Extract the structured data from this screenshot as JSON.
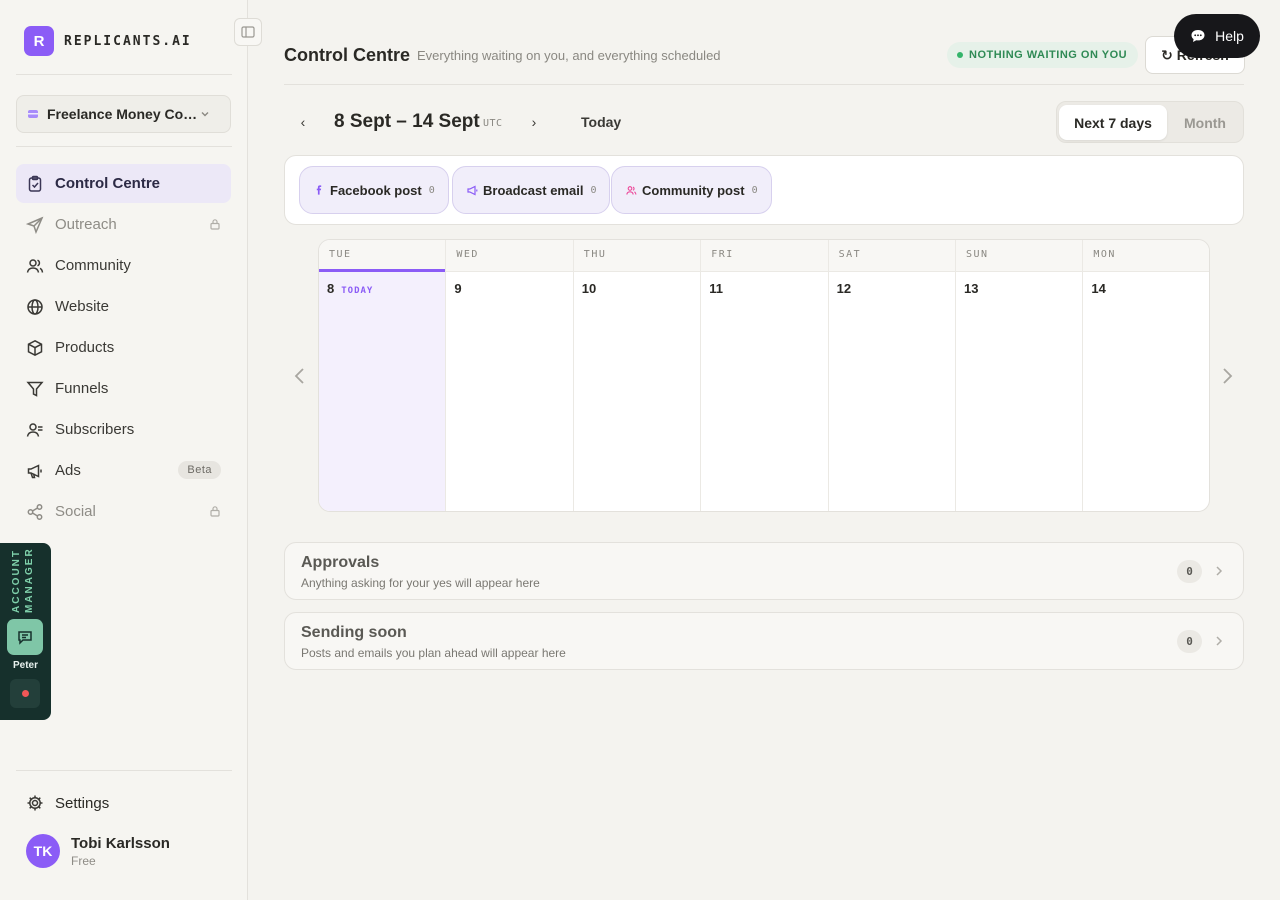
{
  "brand": {
    "logo_letter": "R",
    "name": "REPLICANTS.AI",
    "accent_color": "#8b5cf6"
  },
  "workspace": {
    "label": "Freelance Money Con..."
  },
  "sidebar": {
    "items": [
      {
        "label": "Control Centre",
        "icon": "clipboard-check-icon",
        "active": true
      },
      {
        "label": "Outreach",
        "icon": "send-icon",
        "locked": true
      },
      {
        "label": "Community",
        "icon": "users-icon"
      },
      {
        "label": "Website",
        "icon": "globe-icon"
      },
      {
        "label": "Products",
        "icon": "box-icon"
      },
      {
        "label": "Funnels",
        "icon": "funnel-icon"
      },
      {
        "label": "Subscribers",
        "icon": "subscribers-icon"
      },
      {
        "label": "Ads",
        "icon": "megaphone-icon",
        "badge": "Beta"
      },
      {
        "label": "Social",
        "icon": "share-icon",
        "locked": true
      }
    ],
    "settings_label": "Settings"
  },
  "user": {
    "initials": "TK",
    "name": "Tobi Karlsson",
    "plan": "Free"
  },
  "account_manager": {
    "label": "ACCOUNT MANAGER",
    "name": "Peter",
    "status_color": "#f25757"
  },
  "header": {
    "title": "Control Centre",
    "subtitle": "Everything waiting on you, and everything scheduled",
    "status": "NOTHING WAITING ON YOU",
    "refresh_label": "↻ Refresh",
    "help_label": "Help"
  },
  "week": {
    "prev": "‹",
    "range": "8 Sept – 14 Sept",
    "timezone": "UTC",
    "next": "›",
    "today_label": "Today",
    "views": [
      "Next 7 days",
      "Month"
    ],
    "selected_view": "Next 7 days"
  },
  "filters": [
    {
      "label": "Facebook post",
      "count": "0",
      "icon": "facebook-icon",
      "color": "#8b5cf6"
    },
    {
      "label": "Broadcast email",
      "count": "0",
      "icon": "megaphone-small-icon",
      "color": "#8b5cf6"
    },
    {
      "label": "Community post",
      "count": "0",
      "icon": "users-small-icon",
      "color": "#ec4899"
    }
  ],
  "calendar": {
    "days": [
      {
        "dow": "TUE",
        "date": "8",
        "today": true,
        "today_tag": "TODAY"
      },
      {
        "dow": "WED",
        "date": "9"
      },
      {
        "dow": "THU",
        "date": "10"
      },
      {
        "dow": "FRI",
        "date": "11"
      },
      {
        "dow": "SAT",
        "date": "12"
      },
      {
        "dow": "SUN",
        "date": "13"
      },
      {
        "dow": "MON",
        "date": "14"
      }
    ]
  },
  "queues": [
    {
      "title": "Approvals",
      "subtitle": "Anything asking for your yes will appear here",
      "count": "0"
    },
    {
      "title": "Sending soon",
      "subtitle": "Posts and emails you plan ahead will appear here",
      "count": "0"
    }
  ]
}
